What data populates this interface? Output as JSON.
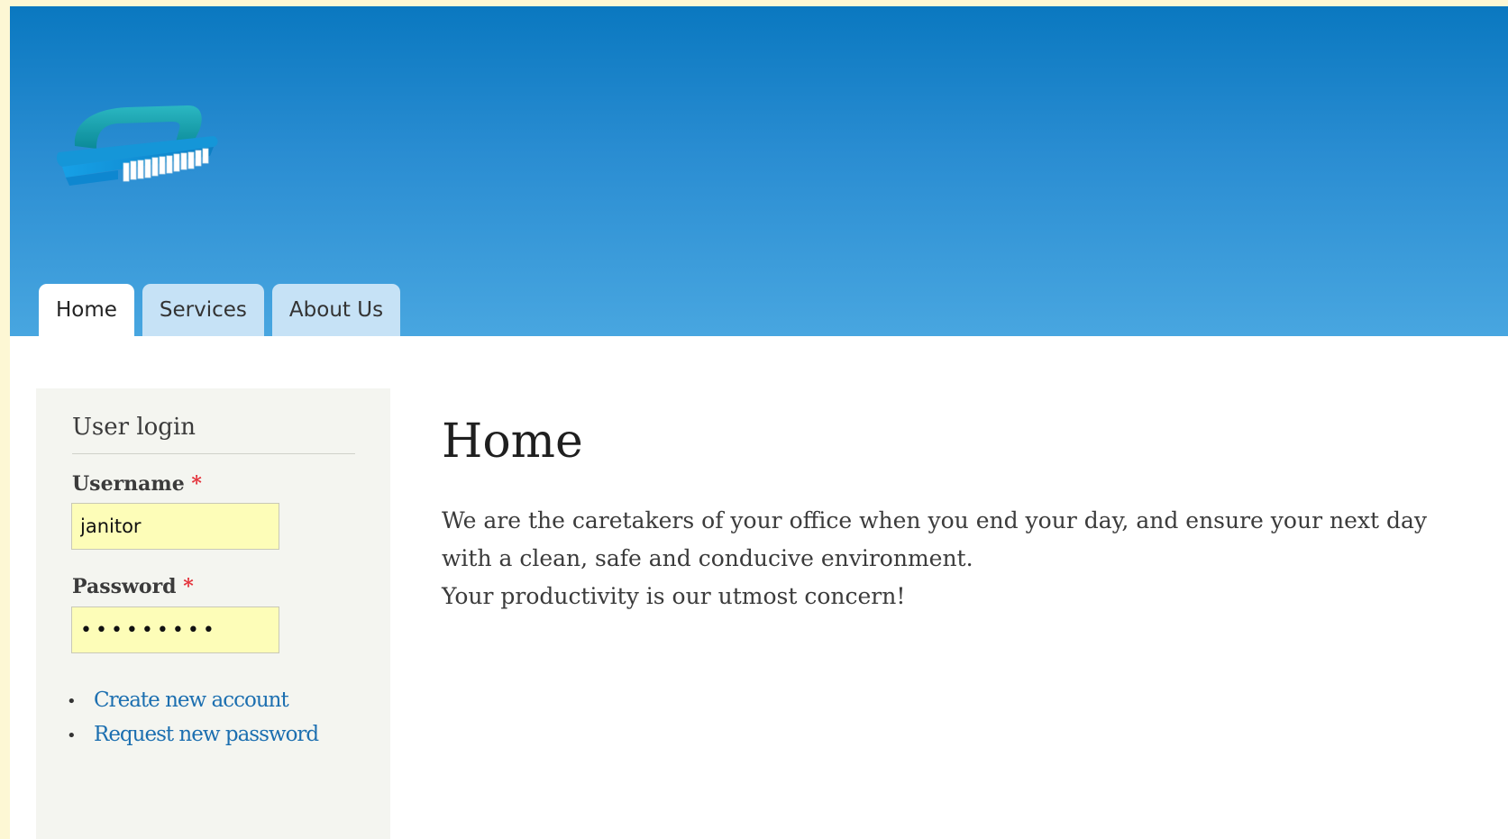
{
  "nav": {
    "tabs": [
      {
        "label": "Home",
        "active": true
      },
      {
        "label": "Services",
        "active": false
      },
      {
        "label": "About Us",
        "active": false
      }
    ]
  },
  "logo": {
    "icon": "scrub-brush-icon"
  },
  "login": {
    "title": "User login",
    "username_label": "Username",
    "username_value": "janitor",
    "password_label": "Password",
    "password_masked": "•••••••••",
    "required_marker": "*",
    "links": [
      "Create new account",
      "Request new password"
    ]
  },
  "main": {
    "title": "Home",
    "paragraph_lines": [
      "We are the caretakers of your office when you end your day, and ensure your next day",
      "with a clean, safe and conducive environment.",
      "Your productivity is our utmost concern!"
    ]
  },
  "colors": {
    "header_top": "#0a78c0",
    "header_bottom": "#48a6e0",
    "tab_inactive": "#c6e2f6",
    "input_bg": "#fdfdb8",
    "sidebar_bg": "#f4f5f0",
    "link": "#1c6fb0",
    "required": "#e4313a",
    "page_border": "#fdf7d4"
  }
}
